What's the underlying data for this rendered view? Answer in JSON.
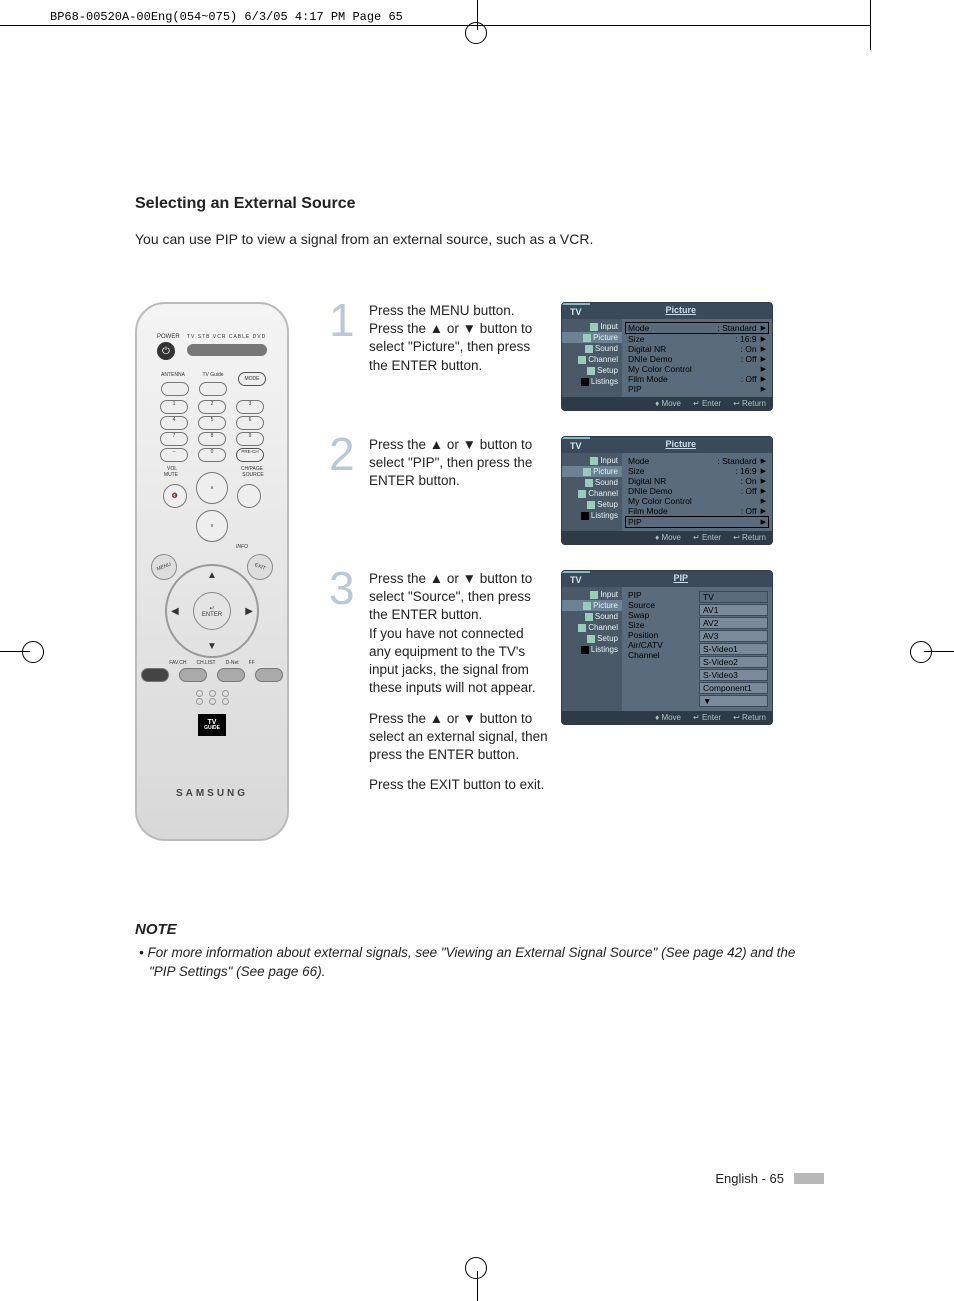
{
  "print_header": "BP68-00520A-00Eng(054~075)  6/3/05  4:17 PM  Page 65",
  "section_title": "Selecting an External Source",
  "intro": "You can use PIP to view a signal from an external source, such as a VCR.",
  "remote": {
    "power_label": "POWER",
    "device_labels": "TV  STB  VCR  CABLE  DVD",
    "row_antenna": "ANTENNA",
    "row_tvguide": "TV Guide",
    "row_mode": "MODE",
    "num": [
      "1",
      "2",
      "3",
      "4",
      "5",
      "6",
      "7",
      "8",
      "9",
      "0"
    ],
    "dash": "–",
    "prech": "PRE-CH",
    "vol": "VOL",
    "chpage": "CH/PAGE",
    "mute": "MUTE",
    "source": "SOURCE",
    "info": "INFO",
    "menu": "MENU",
    "exit": "EXIT",
    "enter_icon": "↵",
    "enter": "ENTER",
    "favch": "FAV.CH",
    "chlist": "CH.LIST",
    "dnet": "D-Net",
    "ff": "FF",
    "tvguide_logo_top": "TV",
    "tvguide_logo_bot": "GUIDE",
    "brand": "SAMSUNG"
  },
  "steps": [
    {
      "num": "1",
      "text": "Press the MENU button.\nPress the ▲ or ▼ button to select \"Picture\", then press the ENTER button.",
      "osd": {
        "left_tab": "TV",
        "title": "Picture",
        "side": [
          "Input",
          "Picture",
          "Sound",
          "Channel",
          "Setup",
          "Listings"
        ],
        "side_active": "Picture",
        "rows": [
          {
            "k": "Mode",
            "v": ": Standard",
            "boxed": true
          },
          {
            "k": "Size",
            "v": ": 16:9"
          },
          {
            "k": "Digital NR",
            "v": ": On"
          },
          {
            "k": "DNIe Demo",
            "v": ": Off"
          },
          {
            "k": "My Color Control",
            "v": ""
          },
          {
            "k": "Film Mode",
            "v": ": Off"
          },
          {
            "k": "PIP",
            "v": ""
          }
        ],
        "foot": [
          "Move",
          "Enter",
          "Return"
        ]
      }
    },
    {
      "num": "2",
      "text": "Press the ▲ or ▼ button to select \"PIP\", then press the ENTER button.",
      "osd": {
        "left_tab": "TV",
        "title": "Picture",
        "side": [
          "Input",
          "Picture",
          "Sound",
          "Channel",
          "Setup",
          "Listings"
        ],
        "side_active": "Picture",
        "rows": [
          {
            "k": "Mode",
            "v": ": Standard"
          },
          {
            "k": "Size",
            "v": ": 16:9"
          },
          {
            "k": "Digital NR",
            "v": ": On"
          },
          {
            "k": "DNIe Demo",
            "v": ": Off"
          },
          {
            "k": "My Color Control",
            "v": ""
          },
          {
            "k": "Film Mode",
            "v": ": Off"
          },
          {
            "k": "PIP",
            "v": "",
            "boxed": true
          }
        ],
        "foot": [
          "Move",
          "Enter",
          "Return"
        ]
      }
    },
    {
      "num": "3",
      "text_a": "Press the ▲ or ▼ button to select \"Source\", then press the ENTER button.\nIf you have not connected any equipment to the TV's input jacks, the signal from these inputs will not appear.",
      "text_b": "Press the ▲ or ▼ button to select an external signal, then press the ENTER button.",
      "text_c": "Press the EXIT button to exit.",
      "osd": {
        "left_tab": "TV",
        "title": "PIP",
        "side": [
          "Input",
          "Picture",
          "Sound",
          "Channel",
          "Setup",
          "Listings"
        ],
        "side_active": "Picture",
        "left_list": [
          "PIP",
          "Source",
          "Swap",
          "Size",
          "Position",
          "Air/CATV",
          "Channel"
        ],
        "options": [
          "TV",
          "AV1",
          "AV2",
          "AV3",
          "S-Video1",
          "S-Video2",
          "S-Video3",
          "Component1",
          "▼"
        ],
        "option_sel": "TV",
        "foot": [
          "Move",
          "Enter",
          "Return"
        ]
      }
    }
  ],
  "note": {
    "heading": "NOTE",
    "body": "•  For more information about external signals, see \"Viewing an External Signal Source\" (See page 42) and the \"PIP Settings\" (See page 66)."
  },
  "page_number": "English - 65"
}
